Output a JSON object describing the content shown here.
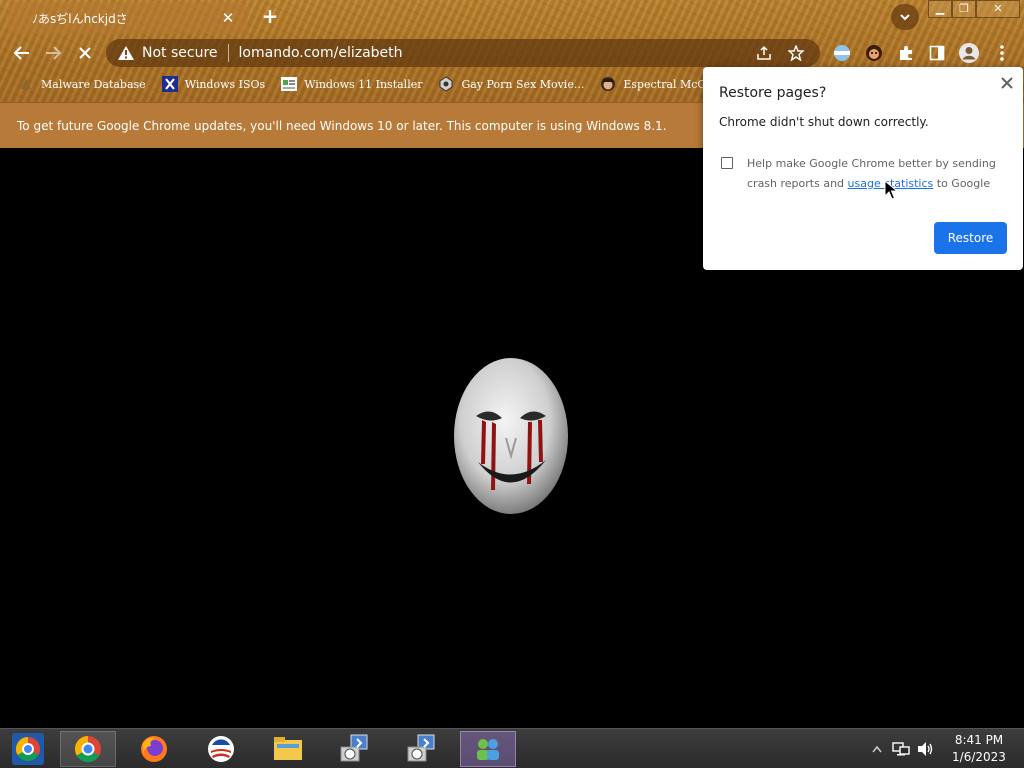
{
  "tab": {
    "title": "ﾉあsぢlんhckjdさ",
    "close_glyph": "✕",
    "new_tab_glyph": "+"
  },
  "window_controls": {
    "minimize_glyph": "▁",
    "maximize_glyph": "❐",
    "close_glyph": "✕"
  },
  "omnibox": {
    "security_label": "Not secure",
    "url": "lomando.com/elizabeth"
  },
  "bookmarks": [
    {
      "label": "Malware Database",
      "icon": "malware-icon"
    },
    {
      "label": "Windows ISOs",
      "icon": "x-logo-icon"
    },
    {
      "label": "Windows 11 Installer",
      "icon": "installer-icon"
    },
    {
      "label": "Gay Porn Sex Movie...",
      "icon": "movie-icon"
    },
    {
      "label": "Espectral McGee",
      "icon": "avatar-icon"
    }
  ],
  "info_bar": {
    "message": "To get future Google Chrome updates, you'll need Windows 10 or later. This computer is using Windows 8.1."
  },
  "restore_dialog": {
    "title": "Restore pages?",
    "message": "Chrome didn't shut down correctly.",
    "consent_prefix": "Help make Google Chrome better by sending crash reports and ",
    "consent_link": "usage statistics",
    "consent_suffix": " to Google",
    "restore_label": "Restore"
  },
  "clock": {
    "time": "8:41 PM",
    "date": "1/6/2023"
  },
  "colors": {
    "theme_brown": "#a86f25",
    "info_bar": "#b77a38",
    "accent_blue": "#1a73e8",
    "taskbar": "#2b2b2b"
  }
}
